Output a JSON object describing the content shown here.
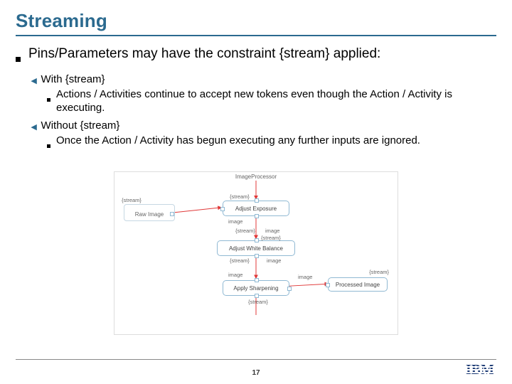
{
  "title": "Streaming",
  "lvl1": "Pins/Parameters may have the constraint {stream} applied:",
  "bullets": {
    "b1": "With {stream}",
    "b1a": "Actions / Activities continue to accept new tokens even though the Action / Activity is executing.",
    "b2": "Without {stream}",
    "b2a": "Once the Action / Activity has begun executing any further inputs are ignored."
  },
  "diagram": {
    "procname": "ImageProcessor",
    "raw": "Raw Image",
    "adjExposure": "Adjust Exposure",
    "adjWhite": "Adjust White Balance",
    "sharpen": "Apply Sharpening",
    "processed": "Processed Image",
    "img": "image",
    "stream": "{stream}"
  },
  "page": "17",
  "logo": {
    "a": "I",
    "b": "B",
    "c": "M"
  }
}
